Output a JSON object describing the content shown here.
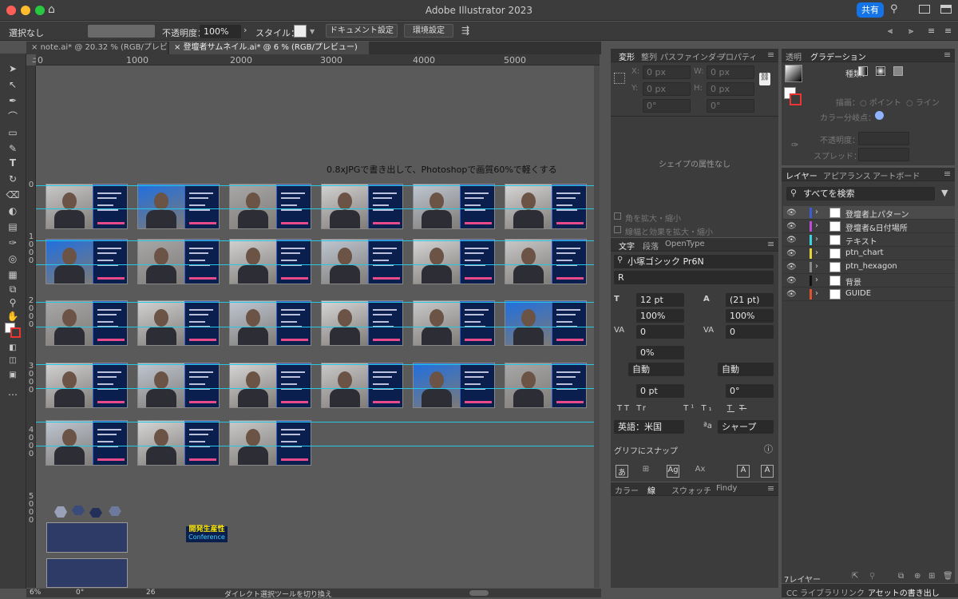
{
  "window": {
    "title": "Adobe Illustrator 2023",
    "share": "共有"
  },
  "control": {
    "selection": "選択なし",
    "opacity_label": "不透明度：",
    "opacity": "100%",
    "style_label": "スタイル：",
    "doc_settings": "ドキュメント設定",
    "prefs": "環境設定"
  },
  "tabs": [
    {
      "name": "note.ai* @ 20.32 % (RGB/プレビュー)"
    },
    {
      "name": "登壇者サムネイル.ai* @ 6 % (RGB/プレビュー)"
    }
  ],
  "ruler_h": [
    "0",
    "1000",
    "2000",
    "3000",
    "4000",
    "5000"
  ],
  "ruler_v": [
    "0",
    "1000",
    "2000",
    "3000",
    "4000",
    "5000"
  ],
  "caption": "0.8xJPGで書き出して、Photoshopで画質60%で軽くする",
  "logo": {
    "line1": "開発生産性",
    "line2": "Conference"
  },
  "status": {
    "zoom": "6%",
    "angle": "0°",
    "page": "26",
    "tool": "ダイレクト選択ツールを切り換え"
  },
  "transform": {
    "tabs": [
      "変形",
      "整列",
      "パスファインダー",
      "プロパティ"
    ],
    "x": "0 px",
    "y": "0 px",
    "w": "0 px",
    "h": "0 px",
    "rot": "0°",
    "shear": "0°",
    "empty": "シェイプの属性なし",
    "scale_corners": "角を拡大・縮小",
    "scale_strokes": "線幅と効果を拡大・縮小"
  },
  "type": {
    "tabs": [
      "文字",
      "段落",
      "OpenType"
    ],
    "font": "小塚ゴシック Pr6N",
    "style": "R",
    "size": "12 pt",
    "leading": "(21 pt)",
    "vscale": "100%",
    "hscale": "100%",
    "kern": "0",
    "track": "0",
    "tsume": "0%",
    "aki1": "自動",
    "aki2": "自動",
    "baseline": "0 pt",
    "rotate": "0°",
    "lang": "英語：米国",
    "aa": "シャープ",
    "snap": "グリフにスナップ",
    "tt": [
      "TT",
      "Tr",
      "T¹",
      "T₁",
      "T",
      "T"
    ]
  },
  "colorpanel": {
    "tabs": [
      "カラー",
      "線",
      "スウォッチ",
      "Findy"
    ]
  },
  "gradient": {
    "tabs": [
      "透明",
      "グラデーション"
    ],
    "type_label": "種類：",
    "stroke_label": "描画：",
    "point": "ポイント",
    "line": "ライン",
    "color_stop": "カラー分岐点：",
    "opacity": "不透明度：",
    "spread": "スプレッド："
  },
  "layers": {
    "tabs": [
      "レイヤー",
      "アピアランス",
      "アートボード"
    ],
    "search": "すべてを検索",
    "count": "7レイヤー",
    "items": [
      {
        "name": "登壇者上パターン",
        "color": "#3b5bdb"
      },
      {
        "name": "登壇者&日付場所",
        "color": "#c04bd6"
      },
      {
        "name": "テキスト",
        "color": "#3ad3e0"
      },
      {
        "name": "ptn_chart",
        "color": "#e6d23b"
      },
      {
        "name": "ptn_hexagon",
        "color": "#8a8a8a"
      },
      {
        "name": "背景",
        "color": "#111111"
      },
      {
        "name": "GUIDE",
        "color": "#e0522d"
      }
    ]
  },
  "bottomtabs": [
    "CC ライブラリ",
    "リンク",
    "アセットの書き出し"
  ],
  "icons": [
    "home-icon",
    "search-icon",
    "selection-tool-icon",
    "direct-selection-icon",
    "pen-icon",
    "type-icon",
    "eye-icon",
    "chevron-right-icon",
    "link-icon",
    "trash-icon"
  ]
}
